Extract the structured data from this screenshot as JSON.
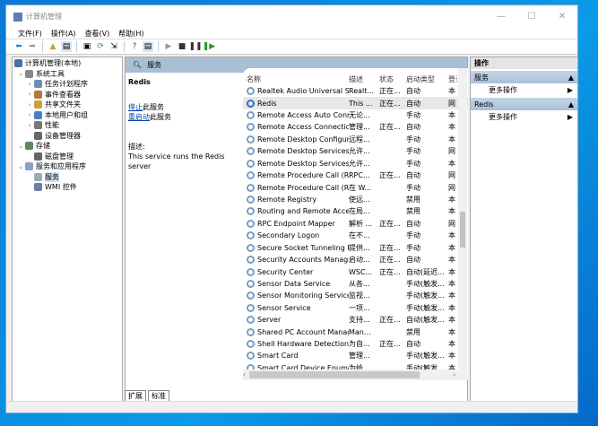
{
  "window": {
    "title": "计算机管理",
    "controls": [
      "—",
      "☐",
      "✕"
    ]
  },
  "menu": [
    "文件(F)",
    "操作(A)",
    "查看(V)",
    "帮助(H)"
  ],
  "toolbar": [
    "back",
    "forward",
    "up",
    "show-tree",
    "properties",
    "refresh",
    "export",
    "help",
    "console",
    "play",
    "stop",
    "pause",
    "resume"
  ],
  "tree": [
    {
      "label": "计算机管理(本地)",
      "level": 0,
      "expander": ""
    },
    {
      "label": "系统工具",
      "level": 1,
      "expander": "⌄"
    },
    {
      "label": "任务计划程序",
      "level": 2,
      "expander": "›"
    },
    {
      "label": "事件查看器",
      "level": 2,
      "expander": "›"
    },
    {
      "label": "共享文件夹",
      "level": 2,
      "expander": "›"
    },
    {
      "label": "本地用户和组",
      "level": 2,
      "expander": "›"
    },
    {
      "label": "性能",
      "level": 2,
      "expander": "›"
    },
    {
      "label": "设备管理器",
      "level": 2,
      "expander": ""
    },
    {
      "label": "存储",
      "level": 1,
      "expander": "⌄"
    },
    {
      "label": "磁盘管理",
      "level": 2,
      "expander": ""
    },
    {
      "label": "服务和应用程序",
      "level": 1,
      "expander": "⌄"
    },
    {
      "label": "服务",
      "level": 2,
      "expander": "",
      "selected": true
    },
    {
      "label": "WMI 控件",
      "level": 2,
      "expander": ""
    }
  ],
  "services_header": "服务",
  "detail": {
    "name": "Redis",
    "stop_link": "停止",
    "stop_suffix": "此服务",
    "restart_link": "重启动",
    "restart_suffix": "此服务",
    "desc_label": "描述:",
    "desc": "This service runs the Redis server"
  },
  "columns": [
    "名称",
    "描述",
    "状态",
    "启动类型",
    "登录为"
  ],
  "rows": [
    [
      "Realtek Audio Universal Se...",
      "Realt...",
      "正在...",
      "自动",
      "本"
    ],
    [
      "Redis",
      "This ...",
      "正在...",
      "自动",
      "网"
    ],
    [
      "Remote Access Auto Conn...",
      "无论...",
      "",
      "手动",
      "本"
    ],
    [
      "Remote Access Connectio...",
      "管理...",
      "正在...",
      "自动",
      "本"
    ],
    [
      "Remote Desktop Configur...",
      "远程...",
      "",
      "手动",
      "本"
    ],
    [
      "Remote Desktop Services",
      "允许...",
      "",
      "手动",
      "网"
    ],
    [
      "Remote Desktop Services ...",
      "允许...",
      "",
      "手动",
      "本"
    ],
    [
      "Remote Procedure Call (R...",
      "RPC...",
      "正在...",
      "自动",
      "网"
    ],
    [
      "Remote Procedure Call (R...",
      "在 W...",
      "",
      "手动",
      "网"
    ],
    [
      "Remote Registry",
      "使远...",
      "",
      "禁用",
      "本"
    ],
    [
      "Routing and Remote Access",
      "在局...",
      "",
      "禁用",
      "本"
    ],
    [
      "RPC Endpoint Mapper",
      "解析 ...",
      "正在...",
      "自动",
      "网"
    ],
    [
      "Secondary Logon",
      "在不...",
      "",
      "手动",
      "本"
    ],
    [
      "Secure Socket Tunneling P...",
      "提供...",
      "正在...",
      "手动",
      "本"
    ],
    [
      "Security Accounts Manager",
      "启动...",
      "正在...",
      "自动",
      "本"
    ],
    [
      "Security Center",
      "WSC...",
      "正在...",
      "自动(延迟...",
      "本"
    ],
    [
      "Sensor Data Service",
      "从各...",
      "",
      "手动(触发...",
      "本"
    ],
    [
      "Sensor Monitoring Service",
      "监视...",
      "",
      "手动(触发...",
      "本"
    ],
    [
      "Sensor Service",
      "一项...",
      "",
      "手动(触发...",
      "本"
    ],
    [
      "Server",
      "支持...",
      "正在...",
      "自动(触发...",
      "本"
    ],
    [
      "Shared PC Account Manager",
      "Man...",
      "",
      "禁用",
      "本"
    ],
    [
      "Shell Hardware Detection",
      "为自...",
      "正在...",
      "自动",
      "本"
    ],
    [
      "Smart Card",
      "管理...",
      "",
      "手动(触发...",
      "本"
    ],
    [
      "Smart Card Device Enumer...",
      "为给...",
      "",
      "手动(触发...",
      "本"
    ]
  ],
  "tabs": [
    "扩展",
    "标准"
  ],
  "actions": {
    "title": "操作",
    "groups": [
      {
        "label": "服务",
        "item": "更多操作"
      },
      {
        "label": "Redis",
        "item": "更多操作"
      }
    ]
  }
}
